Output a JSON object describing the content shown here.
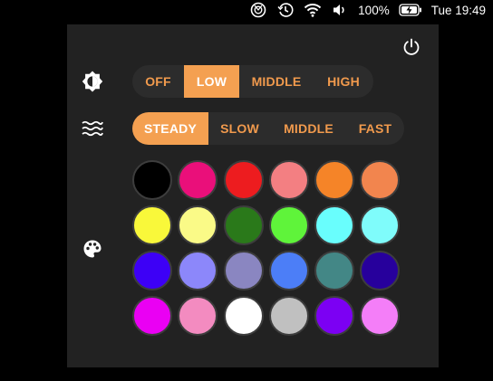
{
  "menubar": {
    "icons": [
      "dnd-icon",
      "time-machine-icon",
      "wifi-icon",
      "volume-icon",
      "battery-charging-icon"
    ],
    "battery_percent": "100%",
    "clock": "Tue 19:49"
  },
  "panel": {
    "icons": {
      "power": "power-icon",
      "brightness": "brightness-icon",
      "waves": "waves-icon",
      "palette": "palette-icon"
    },
    "brightness": {
      "options": [
        "OFF",
        "LOW",
        "MIDDLE",
        "HIGH"
      ],
      "selected": "LOW"
    },
    "speed": {
      "options": [
        "STEADY",
        "SLOW",
        "MIDDLE",
        "FAST"
      ],
      "selected": "STEADY"
    },
    "colors": [
      "#000000",
      "#ea0f7a",
      "#ed1c1f",
      "#f37f82",
      "#f58428",
      "#f2854e",
      "#f9f83a",
      "#fafa87",
      "#2a791a",
      "#5ff43a",
      "#69fefd",
      "#7ffcfb",
      "#3d00f6",
      "#8c87fa",
      "#8a86c1",
      "#4c7ef7",
      "#438786",
      "#27009c",
      "#ea00f3",
      "#f38bc0",
      "#ffffff",
      "#c0c0c0",
      "#7c00f3",
      "#f47ef8"
    ],
    "accent": "#f4a051",
    "accent_text": "#f19a4d"
  }
}
